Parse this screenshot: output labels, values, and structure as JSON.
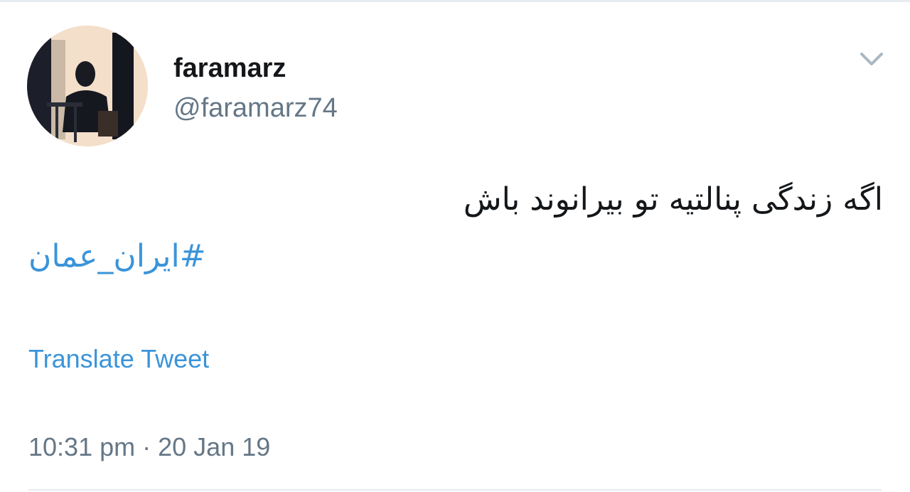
{
  "tweet": {
    "author": {
      "display_name": "faramarz",
      "handle": "@faramarz74",
      "avatar_icon": "user-avatar-photo"
    },
    "menu_icon": "chevron-down-icon",
    "text": "اگه زندگی پنالتیه تو بیرانوند باش",
    "hashtag": "#ایران_عمان",
    "translate_label": "Translate Tweet",
    "time": "10:31 pm",
    "separator": "·",
    "date": "20 Jan 19"
  },
  "colors": {
    "text_primary": "#14171a",
    "text_secondary": "#657786",
    "link": "#3b94d9",
    "divider": "#e6ecf0"
  }
}
